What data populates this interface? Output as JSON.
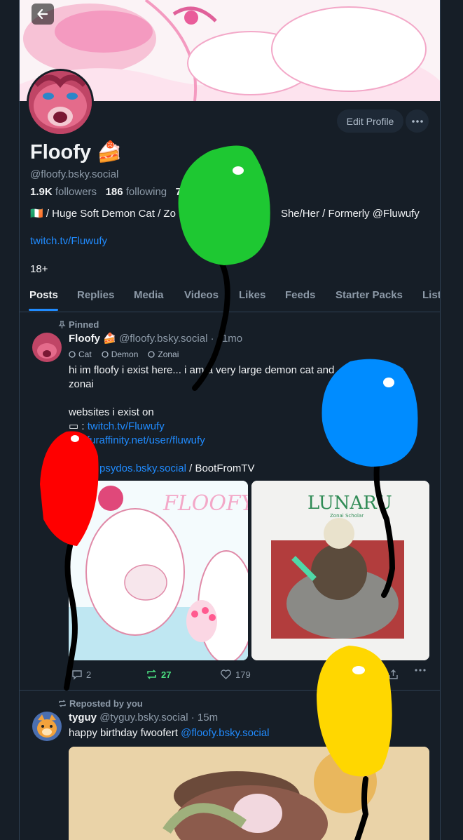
{
  "profile": {
    "display_name": "Floofy 🍰",
    "handle": "@floofy.bsky.social",
    "followers_count": "1.9K",
    "followers_label": "followers",
    "following_count": "186",
    "following_label": "following",
    "posts_count_partial": "7",
    "bio_line": "🇮🇪 / Huge Soft Demon Cat / Zo",
    "bio_line_rest": "She/Her / Formerly @Fluwufy",
    "bio_link": "twitch.tv/Fluwufy",
    "age_label": "18+",
    "edit_label": "Edit Profile"
  },
  "tabs": [
    {
      "label": "Posts"
    },
    {
      "label": "Replies"
    },
    {
      "label": "Media"
    },
    {
      "label": "Videos"
    },
    {
      "label": "Likes"
    },
    {
      "label": "Feeds"
    },
    {
      "label": "Starter Packs"
    },
    {
      "label": "List"
    }
  ],
  "post1": {
    "pinned_label": "Pinned",
    "author": "Floofy 🍰",
    "handle": "@floofy.bsky.social",
    "time": "· 11mo",
    "labels": [
      "Cat",
      "Demon",
      "Zonai"
    ],
    "line1a": "hi im floofy i exist here... i am a very large demon cat and",
    "line1b": "es a",
    "line2": "zonai",
    "line3": "websites i exist on",
    "link1_prefix": ":",
    "link1": "twitch.tv/Fluwufy",
    "link2": "furaffinity.net/user/fluwufy",
    "link3": "psydos.bsky.social",
    "link3_suffix": "/ BootFromTV",
    "image1_title": "FLOOFY",
    "image2_title": "LUNARU",
    "image2_subtitle": "Zonai Scholar",
    "replies": "2",
    "reposts": "27",
    "likes": "179"
  },
  "post2": {
    "repost_label": "Reposted by you",
    "author": "tyguy",
    "handle": "@tyguy.bsky.social",
    "time": "· 15m",
    "text": "happy birthday fwoofert",
    "mention": "@floofy.bsky.social"
  },
  "colors": {
    "accent": "#208bfe",
    "background": "#161e27",
    "repost_active": "#4ade80",
    "balloon_green": "#1ec832",
    "balloon_blue": "#008cff",
    "balloon_red": "#ff0000",
    "balloon_yellow": "#ffd700"
  },
  "icons": [
    "back-arrow-icon",
    "more-icon",
    "pin-icon",
    "reply-icon",
    "repost-icon",
    "heart-icon",
    "share-icon"
  ]
}
